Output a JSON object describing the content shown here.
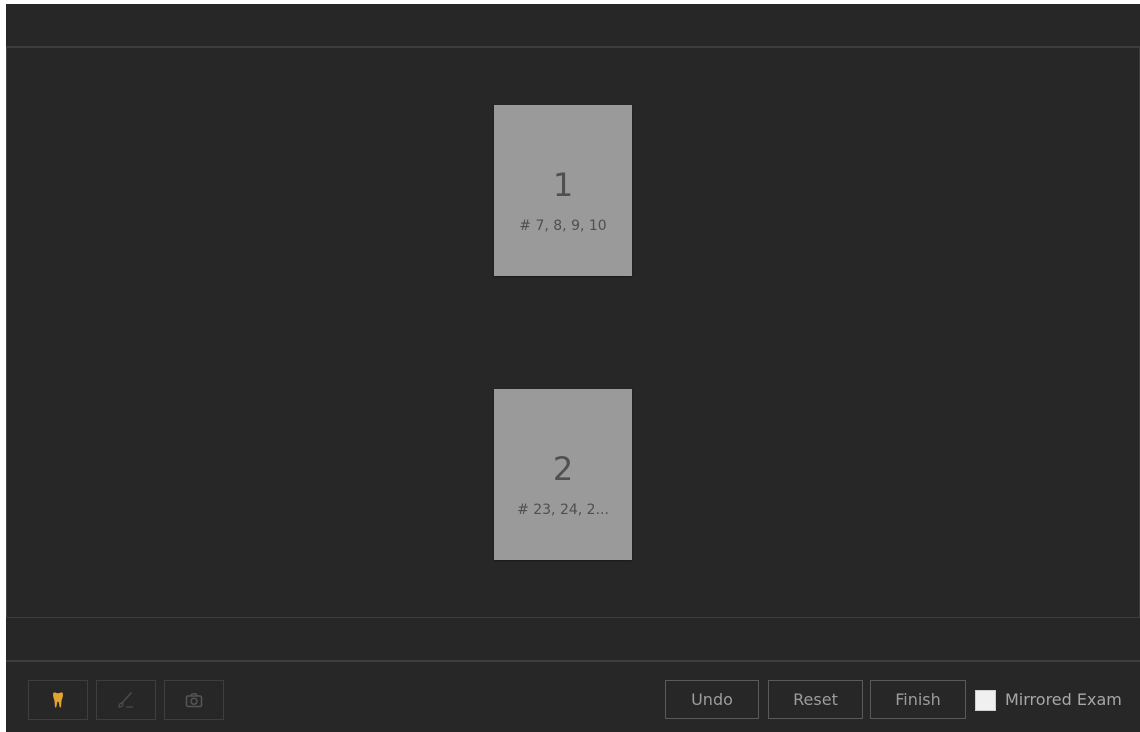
{
  "exam_cards": [
    {
      "number": "1",
      "teeth": "# 7, 8, 9, 10"
    },
    {
      "number": "2",
      "teeth": "# 23, 24, 2..."
    }
  ],
  "toolbar": {
    "tools": [
      {
        "icon": "tooth-icon",
        "active_color": "#e3a52b"
      },
      {
        "icon": "brush-icon"
      },
      {
        "icon": "camera-icon"
      }
    ],
    "undo_label": "Undo",
    "reset_label": "Reset",
    "finish_label": "Finish",
    "mirrored_exam_label": "Mirrored Exam",
    "mirrored_exam_checked": false
  },
  "colors": {
    "background": "#272727",
    "card": "#9a9a9a",
    "accent": "#e3a52b"
  }
}
